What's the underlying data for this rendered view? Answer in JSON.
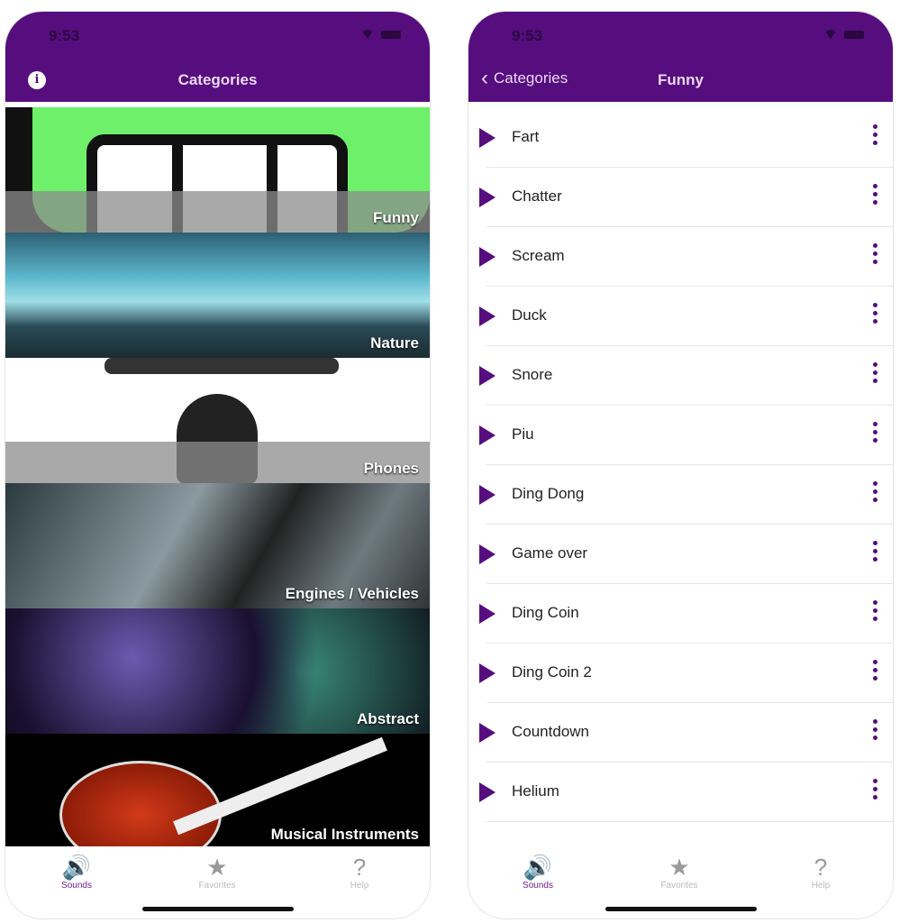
{
  "status": {
    "time": "9:53"
  },
  "left": {
    "title": "Categories",
    "categories": [
      {
        "label": "Funny"
      },
      {
        "label": "Nature"
      },
      {
        "label": "Phones"
      },
      {
        "label": "Engines / Vehicles"
      },
      {
        "label": "Abstract"
      },
      {
        "label": "Musical Instruments"
      }
    ]
  },
  "right": {
    "back_label": "Categories",
    "title": "Funny",
    "sounds": [
      "Fart",
      "Chatter",
      "Scream",
      "Duck",
      "Snore",
      "Piu",
      "Ding Dong",
      "Game over",
      "Ding Coin",
      "Ding Coin 2",
      "Countdown",
      "Helium"
    ]
  },
  "tabs": [
    {
      "label": "Sounds",
      "icon": "speaker-icon",
      "active": true
    },
    {
      "label": "Favorites",
      "icon": "star-icon"
    },
    {
      "label": "Help",
      "icon": "question-icon"
    }
  ],
  "colors": {
    "accent": "#560d7e"
  }
}
